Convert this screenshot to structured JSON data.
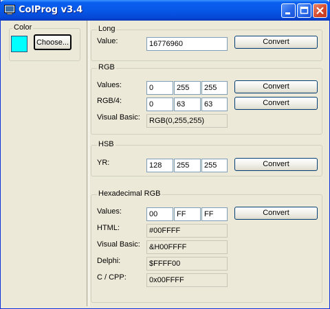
{
  "window": {
    "title": "ColProg v3.4"
  },
  "color_group": {
    "title": "Color",
    "swatch_color": "#00ffff",
    "choose_label": "Choose..."
  },
  "long": {
    "title": "Long",
    "value_label": "Value:",
    "value": "16776960",
    "convert": "Convert"
  },
  "rgb": {
    "title": "RGB",
    "values_label": "Values:",
    "values": [
      "0",
      "255",
      "255"
    ],
    "convert1": "Convert",
    "rgb4_label": "RGB/4:",
    "rgb4": [
      "0",
      "63",
      "63"
    ],
    "convert2": "Convert",
    "vb_label": "Visual Basic:",
    "vb_value": "RGB(0,255,255)"
  },
  "hsb": {
    "title": "HSB",
    "yr_label": "YR:",
    "values": [
      "128",
      "255",
      "255"
    ],
    "convert": "Convert"
  },
  "hex": {
    "title": "Hexadecimal RGB",
    "values_label": "Values:",
    "values": [
      "00",
      "FF",
      "FF"
    ],
    "convert": "Convert",
    "html_label": "HTML:",
    "html_value": "#00FFFF",
    "vb_label": "Visual Basic:",
    "vb_value": "&H00FFFF",
    "delphi_label": "Delphi:",
    "delphi_value": "$FFFF00",
    "cpp_label": "C / CPP:",
    "cpp_value": "0x00FFFF"
  }
}
